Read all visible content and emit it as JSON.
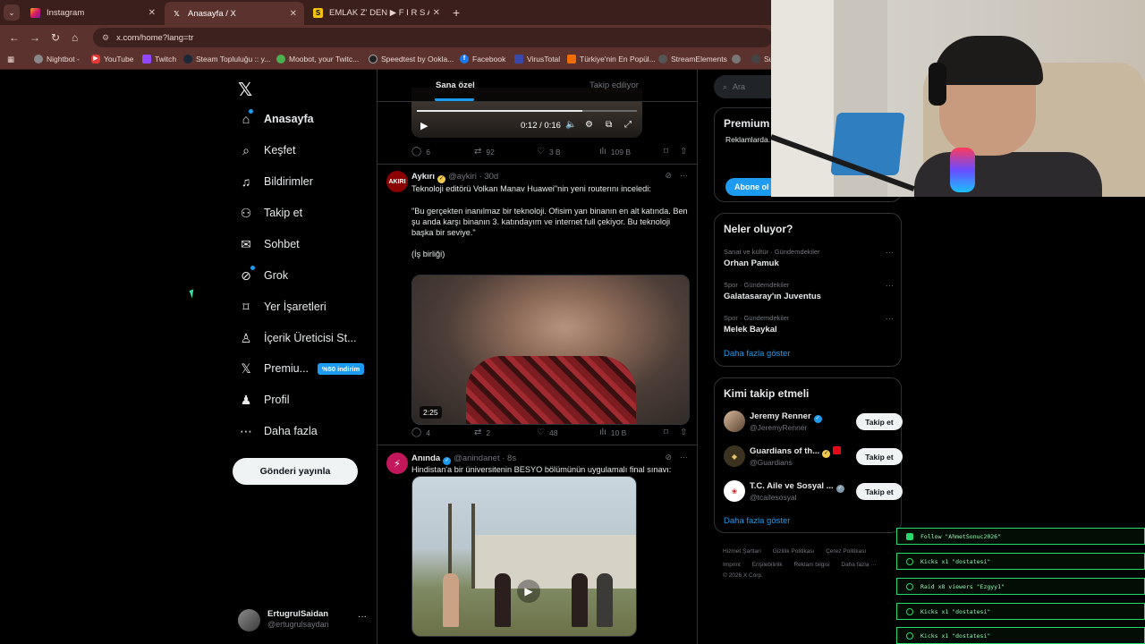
{
  "browser": {
    "tabs": [
      {
        "title": "Instagram"
      },
      {
        "title": "Anasayfa / X"
      },
      {
        "title": "EMLAK Z' DEN ▶ F I R S A T I"
      }
    ],
    "url": "x.com/home?lang=tr",
    "bookmarks": [
      "Nightbot -",
      "YouTube",
      "Twitch",
      "Steam Topluluğu :: y...",
      "Moobot, your Twitc...",
      "Speedtest by Ookla...",
      "Facebook",
      "VirusTotal",
      "Türkiye'nin En Popül...",
      "StreamElements",
      "Su"
    ]
  },
  "nav": {
    "items": [
      {
        "label": "Anasayfa",
        "icon": "home-icon"
      },
      {
        "label": "Keşfet",
        "icon": "search-icon"
      },
      {
        "label": "Bildirimler",
        "icon": "bell-icon"
      },
      {
        "label": "Takip et",
        "icon": "add-person-icon"
      },
      {
        "label": "Sohbet",
        "icon": "mail-icon"
      },
      {
        "label": "Grok",
        "icon": "grok-icon"
      },
      {
        "label": "Yer İşaretleri",
        "icon": "bookmark-icon"
      },
      {
        "label": "İçerik Üreticisi St...",
        "icon": "creator-icon"
      },
      {
        "label": "Premiu...",
        "icon": "x-icon"
      },
      {
        "label": "Profil",
        "icon": "person-icon"
      },
      {
        "label": "Daha fazla",
        "icon": "more-circle-icon"
      }
    ],
    "premium_badge": "%50 indirim",
    "post_button": "Gönderi yayınla",
    "account": {
      "name": "ErtugrulSaidan",
      "handle": "@ertugrulsaydan"
    }
  },
  "timeline": {
    "tabs": [
      "Sana özel",
      "Takip ediliyor"
    ],
    "video1": {
      "time": "0:12 / 0:16",
      "progress": 0.75
    },
    "post1_actions": {
      "replies": "6",
      "reposts": "92",
      "likes": "3 B",
      "views": "109 B"
    },
    "post2": {
      "name": "Aykırı",
      "handle": "@aykiri",
      "age": "30d",
      "avatar_text": "AKIRI",
      "line1": "Teknoloji editörü Volkan Manav Huawei\"nin yeni routerını inceledi:",
      "quote": "\"Bu gerçekten inanılmaz bir teknoloji. Ofisim yan binanın en alt katında. Ben şu anda karşı binanın 3. katındayım ve internet full çekiyor. Bu teknoloji başka bir seviye.\"",
      "footer": "(İş birliği)",
      "duration": "2:25",
      "actions": {
        "replies": "4",
        "reposts": "2",
        "likes": "48",
        "views": "10 B"
      }
    },
    "post3": {
      "name": "Anında",
      "handle": "@anindanet",
      "age": "8s",
      "text": "Hindistan'a bir üniversitenin BESYO bölümünün uygulamalı final sınavı:"
    }
  },
  "sidebar": {
    "search_placeholder": "Ara",
    "premium": {
      "title": "Premium",
      "text": "Reklamlarda... yanıtlarını ö... kilidini aç.",
      "button": "Abone ol"
    },
    "trends_title": "Neler oluyor?",
    "trends": [
      {
        "category": "Sanat ve kültür · Gündemdekiler",
        "topic": "Orhan Pamuk"
      },
      {
        "category": "Spor · Gündemdekiler",
        "topic": "Galatasaray'ın Juventus"
      },
      {
        "category": "Spor · Gündemdekiler",
        "topic": "Melek Baykal"
      }
    ],
    "show_more": "Daha fazla göster",
    "who_title": "Kimi takip etmeli",
    "who": [
      {
        "name": "Jeremy Renner",
        "handle": "@JeremyRenner",
        "button": "Takip et"
      },
      {
        "name": "Guardians of th...",
        "handle": "@Guardians",
        "button": "Takip et"
      },
      {
        "name": "T.C. Aile ve Sosyal ...",
        "handle": "@tcailesosyal",
        "button": "Takip et"
      }
    ],
    "footer_links_1": [
      "Hizmet Şartları",
      "Gizlilik Politikası",
      "Çerez Politikası"
    ],
    "footer_links_2": [
      "Imprint",
      "Erişilebilirlik",
      "Reklam bilgisi",
      "Daha fazla ···"
    ],
    "copyright": "© 2026 X Corp."
  },
  "chat_log": [
    "Follow \"AhmetSonuc2026\"",
    "Kicks x1 \"dostatesi\"",
    "Raid x8 viewers \"Ezgyy1\"",
    "Kicks x1 \"dostatesi\"",
    "Kicks x1 \"dostatesi\""
  ],
  "colors": {
    "accent": "#1d9bf0",
    "chrome": "#5b322d",
    "chat_green": "#29d96b"
  }
}
